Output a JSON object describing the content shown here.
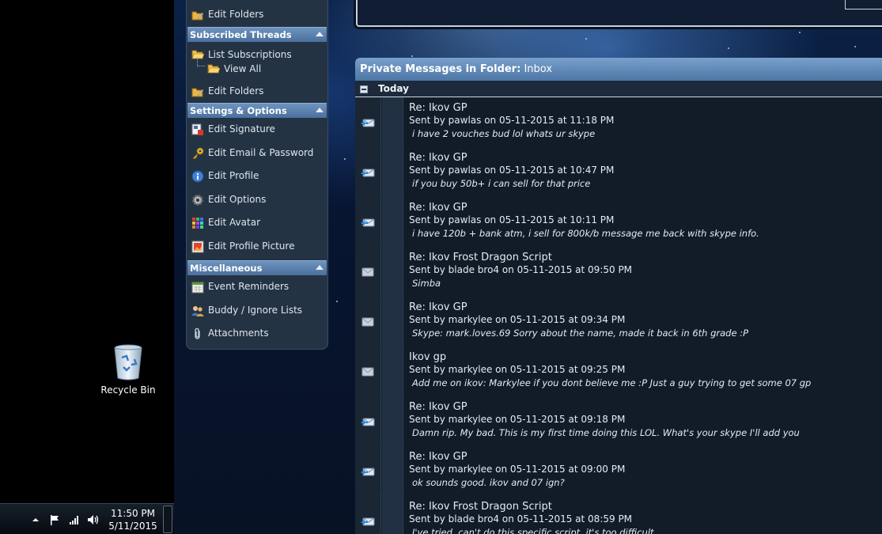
{
  "desktop": {
    "recycle_bin_label": "Recycle Bin"
  },
  "taskbar": {
    "time": "11:50 PM",
    "date": "5/11/2015",
    "icons": [
      "show-hidden-icons-icon",
      "action-center-flag-icon",
      "network-signal-icon",
      "volume-icon"
    ]
  },
  "sidebar": {
    "top_item": "Edit Folders",
    "subscribed": {
      "header": "Subscribed Threads",
      "list_subscriptions": "List Subscriptions",
      "view_all": "View All",
      "edit_folders": "Edit Folders"
    },
    "settings": {
      "header": "Settings & Options",
      "items": [
        "Edit Signature",
        "Edit Email & Password",
        "Edit Profile",
        "Edit Options",
        "Edit Avatar",
        "Edit Profile Picture"
      ]
    },
    "misc": {
      "header": "Miscellaneous",
      "items": [
        "Event Reminders",
        "Buddy / Ignore Lists",
        "Attachments"
      ]
    }
  },
  "pm": {
    "header_prefix": "Private Messages in Folder:",
    "folder": "Inbox",
    "group_label": "Today",
    "messages": [
      {
        "title": "Re: Ikov GP",
        "sent": "Sent by pawlas on 05-11-2015 at 11:18 PM",
        "preview": "i have 2 vouches bud lol whats ur skype",
        "icon": "replied"
      },
      {
        "title": "Re: Ikov GP",
        "sent": "Sent by pawlas on 05-11-2015 at 10:47 PM",
        "preview": "if you buy 50b+ i can sell for that price",
        "icon": "replied"
      },
      {
        "title": "Re: Ikov GP",
        "sent": "Sent by pawlas on 05-11-2015 at 10:11 PM",
        "preview": "i have 120b + bank atm, i sell for 800k/b message me back with skype info.",
        "icon": "replied"
      },
      {
        "title": "Re: Ikov Frost Dragon Script",
        "sent": "Sent by blade bro4 on 05-11-2015 at 09:50 PM",
        "preview": "Simba",
        "icon": "read"
      },
      {
        "title": "Re: Ikov GP",
        "sent": "Sent by markylee on 05-11-2015 at 09:34 PM",
        "preview": "Skype: mark.loves.69 Sorry about the name, made it back in 6th grade :P",
        "icon": "read"
      },
      {
        "title": "Ikov gp",
        "sent": "Sent by markylee on 05-11-2015 at 09:25 PM",
        "preview": "Add me on ikov: Markylee if you dont believe me :P Just a guy trying to get some 07 gp",
        "icon": "read"
      },
      {
        "title": "Re: Ikov GP",
        "sent": "Sent by markylee on 05-11-2015 at 09:18 PM",
        "preview": "Damn rip. My bad. This is my first time doing this LOL. What's your skype I'll add you",
        "icon": "replied"
      },
      {
        "title": "Re: Ikov GP",
        "sent": "Sent by markylee on 05-11-2015 at 09:00 PM",
        "preview": "ok sounds good. ikov and 07 ign?",
        "icon": "replied"
      },
      {
        "title": "Re: Ikov Frost Dragon Script",
        "sent": "Sent by blade bro4 on 05-11-2015 at 08:59 PM",
        "preview": "I've tried, can't do this specific script, it's too difficult",
        "icon": "replied"
      }
    ]
  }
}
